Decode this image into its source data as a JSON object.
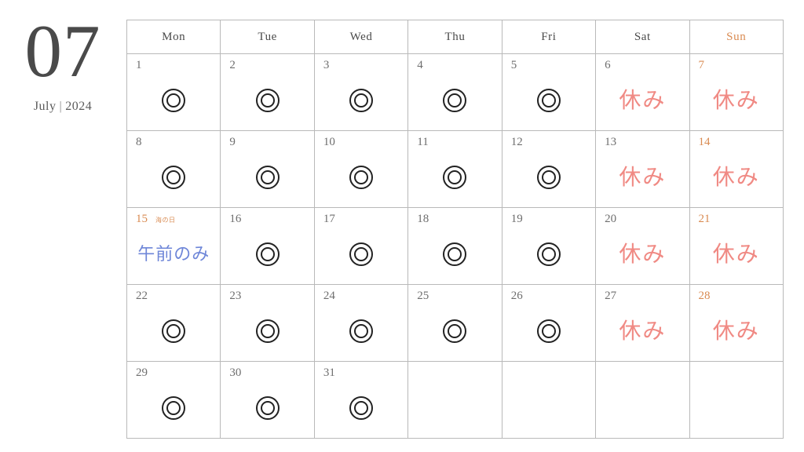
{
  "header": {
    "month_number": "07",
    "month_name": "July",
    "separator": "|",
    "year": "2024"
  },
  "colors": {
    "sunday_accent": "#d98b52",
    "closed": "#f08a84",
    "partial": "#6e86d8",
    "grid_line": "#b9b9b9",
    "day_number": "#6e6e6e",
    "mark": "#222222"
  },
  "legend": {
    "open_symbol": "◎",
    "closed_label": "休み",
    "partial_label": "午前のみ"
  },
  "weekdays": [
    {
      "label": "Mon",
      "is_sunday": false
    },
    {
      "label": "Tue",
      "is_sunday": false
    },
    {
      "label": "Wed",
      "is_sunday": false
    },
    {
      "label": "Thu",
      "is_sunday": false
    },
    {
      "label": "Fri",
      "is_sunday": false
    },
    {
      "label": "Sat",
      "is_sunday": false
    },
    {
      "label": "Sun",
      "is_sunday": true
    }
  ],
  "weeks": [
    [
      {
        "day": "1",
        "status": "open",
        "text": "",
        "sunday": false,
        "holiday": ""
      },
      {
        "day": "2",
        "status": "open",
        "text": "",
        "sunday": false,
        "holiday": ""
      },
      {
        "day": "3",
        "status": "open",
        "text": "",
        "sunday": false,
        "holiday": ""
      },
      {
        "day": "4",
        "status": "open",
        "text": "",
        "sunday": false,
        "holiday": ""
      },
      {
        "day": "5",
        "status": "open",
        "text": "",
        "sunday": false,
        "holiday": ""
      },
      {
        "day": "6",
        "status": "closed",
        "text": "休み",
        "sunday": false,
        "holiday": ""
      },
      {
        "day": "7",
        "status": "closed",
        "text": "休み",
        "sunday": true,
        "holiday": ""
      }
    ],
    [
      {
        "day": "8",
        "status": "open",
        "text": "",
        "sunday": false,
        "holiday": ""
      },
      {
        "day": "9",
        "status": "open",
        "text": "",
        "sunday": false,
        "holiday": ""
      },
      {
        "day": "10",
        "status": "open",
        "text": "",
        "sunday": false,
        "holiday": ""
      },
      {
        "day": "11",
        "status": "open",
        "text": "",
        "sunday": false,
        "holiday": ""
      },
      {
        "day": "12",
        "status": "open",
        "text": "",
        "sunday": false,
        "holiday": ""
      },
      {
        "day": "13",
        "status": "closed",
        "text": "休み",
        "sunday": false,
        "holiday": ""
      },
      {
        "day": "14",
        "status": "closed",
        "text": "休み",
        "sunday": true,
        "holiday": ""
      }
    ],
    [
      {
        "day": "15",
        "status": "partial",
        "text": "午前のみ",
        "sunday": true,
        "holiday": "海の日"
      },
      {
        "day": "16",
        "status": "open",
        "text": "",
        "sunday": false,
        "holiday": ""
      },
      {
        "day": "17",
        "status": "open",
        "text": "",
        "sunday": false,
        "holiday": ""
      },
      {
        "day": "18",
        "status": "open",
        "text": "",
        "sunday": false,
        "holiday": ""
      },
      {
        "day": "19",
        "status": "open",
        "text": "",
        "sunday": false,
        "holiday": ""
      },
      {
        "day": "20",
        "status": "closed",
        "text": "休み",
        "sunday": false,
        "holiday": ""
      },
      {
        "day": "21",
        "status": "closed",
        "text": "休み",
        "sunday": true,
        "holiday": ""
      }
    ],
    [
      {
        "day": "22",
        "status": "open",
        "text": "",
        "sunday": false,
        "holiday": ""
      },
      {
        "day": "23",
        "status": "open",
        "text": "",
        "sunday": false,
        "holiday": ""
      },
      {
        "day": "24",
        "status": "open",
        "text": "",
        "sunday": false,
        "holiday": ""
      },
      {
        "day": "25",
        "status": "open",
        "text": "",
        "sunday": false,
        "holiday": ""
      },
      {
        "day": "26",
        "status": "open",
        "text": "",
        "sunday": false,
        "holiday": ""
      },
      {
        "day": "27",
        "status": "closed",
        "text": "休み",
        "sunday": false,
        "holiday": ""
      },
      {
        "day": "28",
        "status": "closed",
        "text": "休み",
        "sunday": true,
        "holiday": ""
      }
    ],
    [
      {
        "day": "29",
        "status": "open",
        "text": "",
        "sunday": false,
        "holiday": ""
      },
      {
        "day": "30",
        "status": "open",
        "text": "",
        "sunday": false,
        "holiday": ""
      },
      {
        "day": "31",
        "status": "open",
        "text": "",
        "sunday": false,
        "holiday": ""
      },
      {
        "day": "",
        "status": "none",
        "text": "",
        "sunday": false,
        "holiday": ""
      },
      {
        "day": "",
        "status": "none",
        "text": "",
        "sunday": false,
        "holiday": ""
      },
      {
        "day": "",
        "status": "none",
        "text": "",
        "sunday": false,
        "holiday": ""
      },
      {
        "day": "",
        "status": "none",
        "text": "",
        "sunday": true,
        "holiday": ""
      }
    ]
  ]
}
